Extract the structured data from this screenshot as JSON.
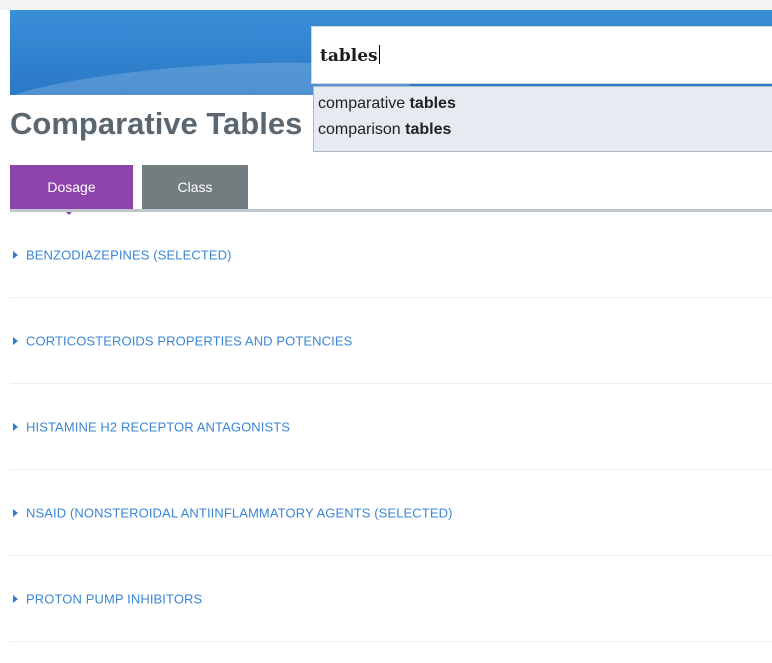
{
  "search": {
    "query": "tables",
    "suggestions": [
      {
        "prefix": "comparative ",
        "match": "tables"
      },
      {
        "prefix": "comparison ",
        "match": "tables"
      }
    ]
  },
  "page": {
    "title": "Comparative Tables"
  },
  "tabs": [
    {
      "label": "Dosage",
      "active": true
    },
    {
      "label": "Class",
      "active": false
    }
  ],
  "items": [
    {
      "label": "BENZODIAZEPINES (SELECTED)"
    },
    {
      "label": "CORTICOSTEROIDS PROPERTIES AND POTENCIES"
    },
    {
      "label": "HISTAMINE H2 RECEPTOR ANTAGONISTS"
    },
    {
      "label": "NSAID (NONSTEROIDAL ANTIINFLAMMATORY AGENTS (SELECTED)"
    },
    {
      "label": "PROTON PUMP INHIBITORS"
    }
  ],
  "colors": {
    "header": "#2a78c6",
    "tab_active": "#8e44ad",
    "tab_inactive": "#717d7e",
    "link": "#3a86d4",
    "title": "#5b6770"
  }
}
